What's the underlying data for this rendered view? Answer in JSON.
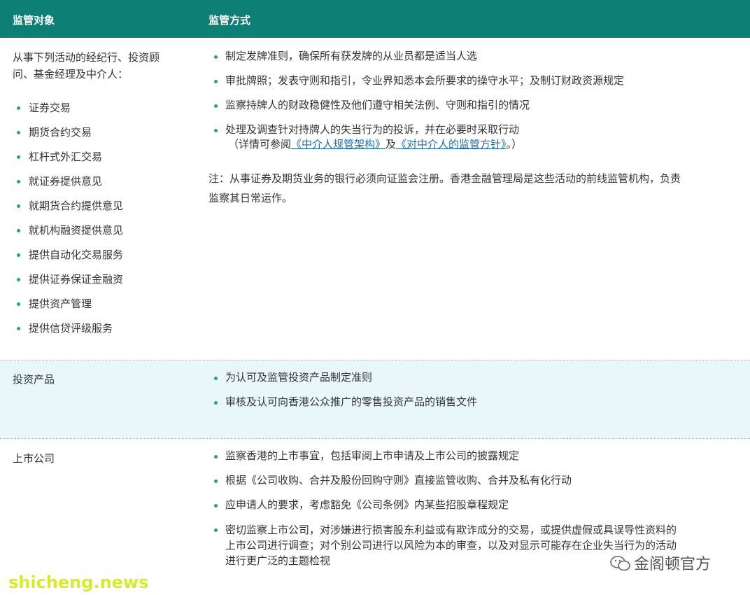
{
  "header": {
    "col1": "监管对象",
    "col2": "监管方式"
  },
  "rows": [
    {
      "left_intro": "从事下列活动的经纪行、投资顾问、基金经理及中介人：",
      "left_intro_line1": "从事下列活动的经纪行、投资顾",
      "left_intro_line2": "问、基金经理及中介人：",
      "left_items": [
        "证券交易",
        "期货合约交易",
        "杠杆式外汇交易",
        "就证券提供意见",
        "就期货合约提供意见",
        "就机构融资提供意见",
        "提供自动化交易服务",
        "提供证券保证金融资",
        "提供资产管理",
        "提供信贷评级服务"
      ],
      "right_items": [
        "制定发牌准则，确保所有获发牌的从业员都是适当人选",
        "审批牌照；发表守则和指引，令业界知悉本会所要求的操守水平；及制订财政资源规定",
        "监察持牌人的财政稳健性及他们遵守相关法例、守则和指引的情况",
        "处理及调查针对持牌人的失当行为的投诉，并在必要时采取行动"
      ],
      "detail_prefix": "（详情可参阅",
      "detail_link1": "《中介人规管架构》",
      "detail_and": "及",
      "detail_link2": "《对中介人的监管方针》",
      "detail_suffix": "。）",
      "note_line1": "注：从事证券及期货业务的银行必须向证监会注册。香港金融管理局是这些活动的前线监管机构，负责",
      "note_line2": "监察其日常运作。"
    },
    {
      "left": "投资产品",
      "right_items": [
        "为认可及监管投资产品制定准则",
        "审核及认可向香港公众推广的零售投资产品的销售文件"
      ]
    },
    {
      "left": "上市公司",
      "right_items": [
        "监察香港的上市事宜，包括审阅上市申请及上市公司的披露规定",
        "根据《公司收购、合并及股份回购守则》直接监管收购、合并及私有化行动",
        "应申请人的要求，考虑豁免《公司条例》内某些招股章程规定"
      ],
      "last_item_line1": "密切监察上市公司，对涉嫌进行损害股东利益或有欺诈成分的交易，或提供虚假或具误导性资料的",
      "last_item_line2": "上市公司进行调查；对个别公司进行以风险为本的审查，以及对显示可能存在企业失当行为的活动",
      "last_item_line3": "进行更广泛的主题检视"
    }
  ],
  "watermark": "shicheng.news",
  "wechat_label": "金阁顿官方",
  "colors": {
    "header": "#0d7f74",
    "shade": "#e9f7f8",
    "bullet": "#2a9e8c",
    "link": "#1c6bad",
    "watermark": "#d8ea2a"
  }
}
